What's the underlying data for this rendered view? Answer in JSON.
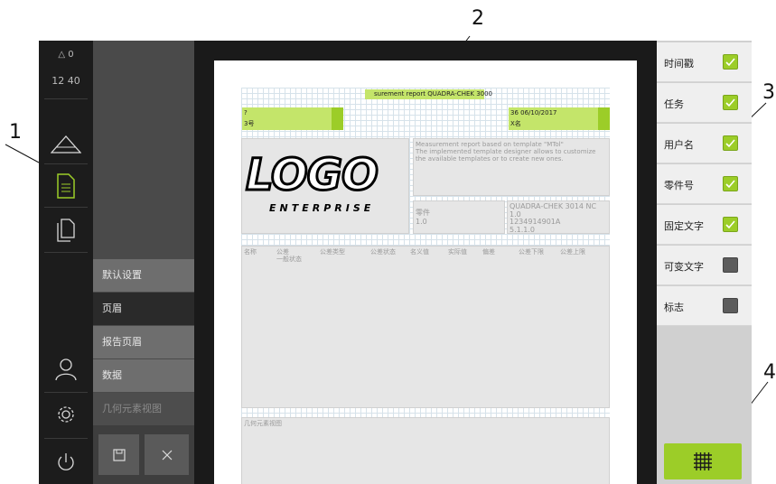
{
  "callouts": [
    "1",
    "2",
    "3",
    "4"
  ],
  "status": {
    "warnings": "0",
    "time": "12 40"
  },
  "nav_icons": [
    "measure-icon",
    "report-icon",
    "files-icon",
    "user-icon",
    "settings-icon",
    "power-icon"
  ],
  "submenu": {
    "items": [
      "默认设置",
      "页眉",
      "报告页眉",
      "数据",
      "几何元素视图"
    ],
    "active_index": 1
  },
  "report": {
    "title": "surement report QUADRA-CHEK 3000",
    "left_field_1": "?",
    "left_field_2": "3号",
    "date": "36 06/10/2017",
    "right_field_2": "X名",
    "logo_main": "LOGO",
    "logo_sub": "ENTERPRISE",
    "info_text": "Measurement report based on template \"MTol\"\nThe implemented template designer allows to customize\nthe available templates or to create new ones.",
    "mid_left": "零件\n1.0",
    "mid_right": "QUADRA-CHEK 3014 NC\n1.0\n1234914901A\n5.1.1.0",
    "columns": [
      "名称",
      "公差\n一般状态",
      "公差类型",
      "公差状态",
      "名义值",
      "实际值",
      "偏差",
      "公差下限",
      "公差上限"
    ],
    "geom_label": "几何元素视图"
  },
  "options": [
    {
      "label": "时间戳",
      "checked": true
    },
    {
      "label": "任务",
      "checked": true
    },
    {
      "label": "用户名",
      "checked": true
    },
    {
      "label": "零件号",
      "checked": true
    },
    {
      "label": "固定文字",
      "checked": true
    },
    {
      "label": "可变文字",
      "checked": false
    },
    {
      "label": "标志",
      "checked": false
    }
  ],
  "colors": {
    "accent": "#9ccd28",
    "report_green": "#c4e56a"
  }
}
